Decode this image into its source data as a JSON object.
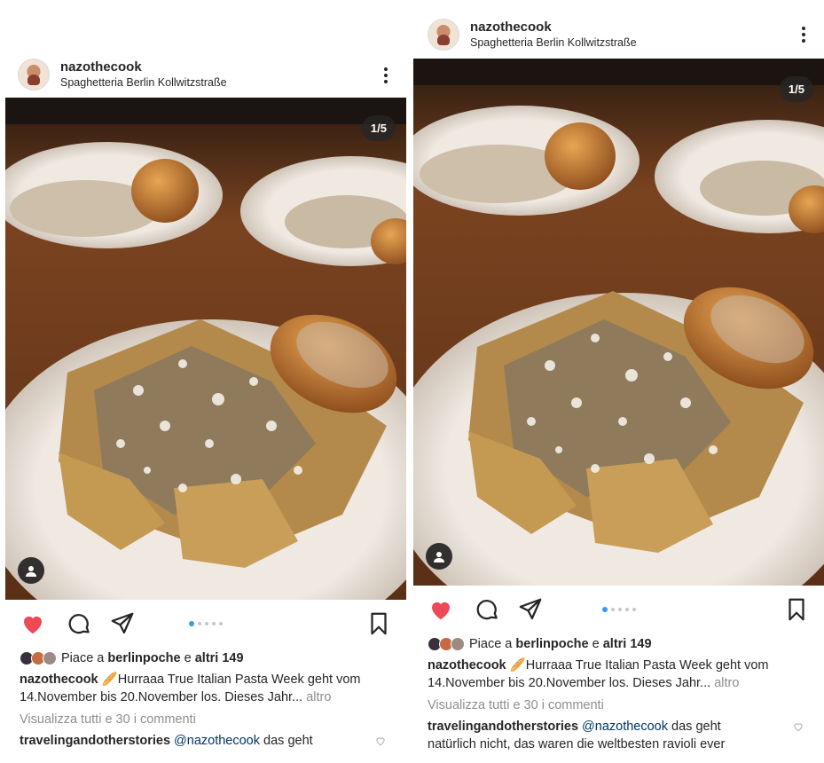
{
  "post": {
    "username": "nazothecook",
    "location": "Spaghetteria Berlin Kollwitzstraße",
    "photo_counter": "1/5",
    "carousel": {
      "count": 5,
      "active_index": 0
    },
    "likes": {
      "prefix": "Piace a",
      "liker": "berlinpoche",
      "conjunction": "e",
      "others": "altri 149"
    },
    "caption": {
      "username": "nazothecook",
      "emoji": "🥖",
      "text_line1": "Hurraaa True Italian Pasta Week geht vom",
      "text_line2": "14.November bis 20.November los. Dieses Jahr...",
      "more": "altro"
    },
    "view_comments": "Visualizza tutti e 30 i commenti",
    "comment": {
      "username": "travelingandotherstories",
      "mention": "@nazothecook",
      "text": "das geht",
      "continuation": "natürlich nicht, das waren die weltbesten ravioli ever"
    }
  },
  "colors": {
    "like_active": "#ed4956",
    "carousel_active": "#3897f0",
    "mention": "#003569",
    "muted": "#8e8e8e"
  },
  "icons": [
    "more-icon",
    "heart-icon",
    "comment-icon",
    "send-icon",
    "save-icon",
    "user-tag-icon",
    "comment-heart-icon"
  ]
}
